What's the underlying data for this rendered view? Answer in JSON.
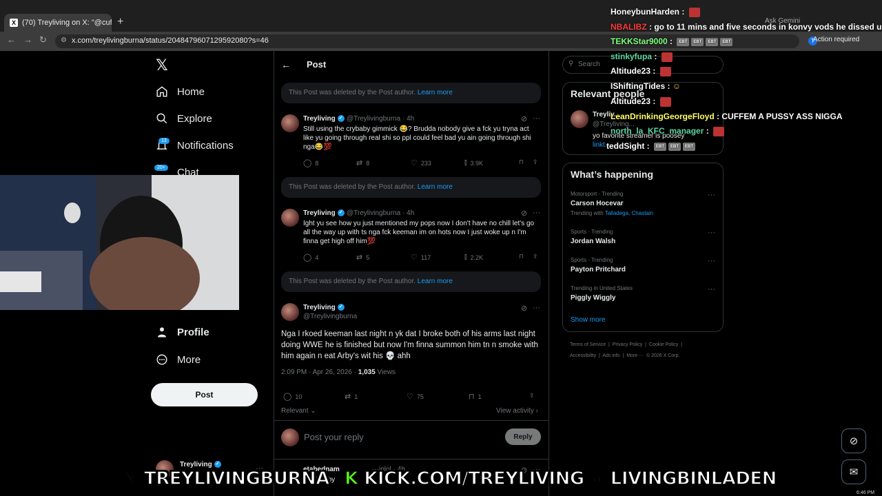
{
  "browser": {
    "tab_title": "(70) Treyliving on X: \"@cuff3m",
    "tab_favicon": "X",
    "url": "x.com/treylivingburna/status/2048479607129592080?s=46",
    "ask_gemini": "Ask Gemini",
    "action_required": "Action required",
    "profile_initial": "T"
  },
  "nav": {
    "home": "Home",
    "explore": "Explore",
    "notifications": "Notifications",
    "notifications_badge": "13",
    "chat": "Chat",
    "chat_badge": "20+",
    "profile": "Profile",
    "more": "More",
    "post_button": "Post"
  },
  "header": {
    "title": "Post"
  },
  "deleted_notice": {
    "text": "This Post was deleted by the Post author.",
    "link": "Learn more"
  },
  "tweets": [
    {
      "name": "Treyliving",
      "handle": "@Treylivingburna",
      "time": "· 4h",
      "text": "Still using the crybaby gimmick 😂? Brudda nobody give a fck yu tryna act like yu going through real shi so ppl could feel bad yu ain going through shi nga😂💯",
      "replies": "8",
      "reposts": "8",
      "likes": "233",
      "views": "3.9K"
    },
    {
      "name": "Treyliving",
      "handle": "@Treylivingburna",
      "time": "· 4h",
      "text": "Ight yu see how yu just mentioned my pops now I don't have no chill let's go all the way up with ts nga fck keeman im on hots now I just woke up n I'm finna get high off him💯",
      "replies": "4",
      "reposts": "5",
      "likes": "117",
      "views": "2.2K"
    }
  ],
  "main_tweet": {
    "name": "Treyliving",
    "handle": "@Treylivingburna",
    "text": "Nga I rkoed keeman last night n yk dat I broke both of his arms last night doing WWE he is finished but now I'm finna summon him tn n smoke with him again n eat Arby's wit his 💀 ahh",
    "timestamp": "2:09 PM · Apr 26, 2026 · ",
    "views_count": "1,035",
    "views_label": " Views",
    "replies": "10",
    "reposts": "1",
    "likes": "75",
    "bookmarks": "1",
    "relevant": "Relevant",
    "view_activity": "View activity"
  },
  "reply_box": {
    "placeholder": "Post your reply",
    "button": "Reply"
  },
  "bottom_reply": {
    "name": "etabednam",
    "handle": "···inlol",
    "time": "· 4h",
    "snippet": "w u 5 arby"
  },
  "bottom_profile": {
    "name": "Treyliving"
  },
  "right": {
    "search_placeholder": "Search",
    "relevant_people_title": "Relevant people",
    "rp_name": "Treyliv...",
    "rp_handle": "@Treyliving...",
    "rp_bio": "yo favorite streamer is poosey",
    "rp_link": "linkt...",
    "whats_happening_title": "What’s happening",
    "trends": [
      {
        "meta": "Motorsport · Trending",
        "name": "Carson Hocevar",
        "with_label": "Trending with ",
        "with_a": "Talladega",
        "with_b": "Chastain"
      },
      {
        "meta": "Sports · Trending",
        "name": "Jordan Walsh"
      },
      {
        "meta": "Sports · Trending",
        "name": "Payton Pritchard"
      },
      {
        "meta": "Trending in United States",
        "name": "Piggly Wiggly"
      }
    ],
    "show_more": "Show more",
    "footer_line1": "Terms of Service  |  Privacy Policy  |  Cookie Policy  |",
    "footer_line2": "Accessibility  |  Ads info  |  More ···  © 2026 X Corp."
  },
  "chat": [
    {
      "user": "HoneybunHarden",
      "color": "#ffffff",
      "msg": ""
    },
    {
      "user": "NBALIBZ",
      "color": "#ff3b3b",
      "msg": "go to 11 mins and five seconds in konvy vods he dissed u"
    },
    {
      "user": "TEKKStar9000",
      "color": "#7dff7d",
      "msg": ""
    },
    {
      "user": "stinkyfupa",
      "color": "#5cd6a0",
      "msg": ""
    },
    {
      "user": "Altitude23",
      "color": "#ffffff",
      "msg": ""
    },
    {
      "user": "IShiftingTides",
      "color": "#ffffff",
      "msg": ""
    },
    {
      "user": "Altitude23",
      "color": "#ffffff",
      "msg": ""
    },
    {
      "user": "LeanDrinkingGeorgeFloyd",
      "color": "#ffff66",
      "msg": "CUFFEM A PUSSY ASS NIGGA"
    },
    {
      "user": "north_la_KFC_manager",
      "color": "#5cd6a0",
      "msg": ""
    },
    {
      "user": "teddSight",
      "color": "#ffffff",
      "msg": ""
    }
  ],
  "chat_emote_text": "EBT",
  "banners": {
    "x": "TREYLIVINGBURNA",
    "kick": "KICK.COM/TREYLIVING",
    "ig": "LIVINGBINLADEN"
  },
  "taskbar_time": "6:46 PM"
}
